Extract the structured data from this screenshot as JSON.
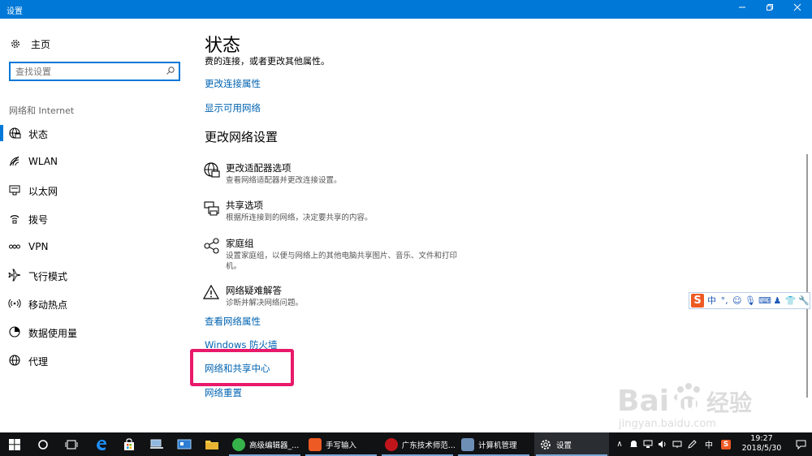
{
  "window": {
    "title": "设置",
    "minimize_icon": "minimize-icon",
    "maximize_icon": "restore-icon",
    "close_icon": "close-icon",
    "accent_color": "#0078d7"
  },
  "sidebar": {
    "home_label": "主页",
    "search_placeholder": "查找设置",
    "section_label": "网络和 Internet",
    "items": [
      {
        "label": "状态",
        "icon": "status-globe-icon",
        "selected": true
      },
      {
        "label": "WLAN",
        "icon": "wifi-icon"
      },
      {
        "label": "以太网",
        "icon": "ethernet-icon"
      },
      {
        "label": "拨号",
        "icon": "dialup-icon"
      },
      {
        "label": "VPN",
        "icon": "vpn-icon"
      },
      {
        "label": "飞行模式",
        "icon": "airplane-icon"
      },
      {
        "label": "移动热点",
        "icon": "hotspot-icon"
      },
      {
        "label": "数据使用量",
        "icon": "data-usage-icon"
      },
      {
        "label": "代理",
        "icon": "proxy-globe-icon"
      }
    ]
  },
  "main": {
    "title": "状态",
    "partial_text": "费的连接，或者更改其他属性。",
    "link_change_connection": "更改连接属性",
    "link_show_networks": "显示可用网络",
    "section_heading": "更改网络设置",
    "settings": [
      {
        "name": "更改适配器选项",
        "desc": "查看网络适配器并更改连接设置。",
        "icon": "adapter-globe-icon"
      },
      {
        "name": "共享选项",
        "desc": "根据所连接到的网络，决定要共享的内容。",
        "icon": "sharing-printer-icon"
      },
      {
        "name": "家庭组",
        "desc": "设置家庭组，以便与网络上的其他电脑共享图片、音乐、文件和打印机。",
        "icon": "homegroup-icon"
      },
      {
        "name": "网络疑难解答",
        "desc": "诊断并解决网络问题。",
        "icon": "warning-triangle-icon"
      }
    ],
    "link_view_properties": "查看网络属性",
    "link_firewall": "Windows 防火墙",
    "link_sharing_center": "网络和共享中心",
    "link_reset": "网络重置",
    "highlight_color": "#e8196a",
    "link_color": "#0063b1"
  },
  "ime_toolbar": {
    "logo": "S",
    "mode": "中",
    "icons": [
      "punctuation-icon",
      "emoji-icon",
      "microphone-icon",
      "keyboard-icon",
      "user-icon",
      "skin-icon",
      "tools-icon"
    ]
  },
  "watermark": {
    "brand": "Bai",
    "brand2": "du",
    "cn": "经验",
    "url": "jingyan.baidu.com"
  },
  "taskbar": {
    "apps": [
      {
        "label": "高级编辑器_...",
        "icon": "advanced-editor-icon",
        "color": "#35b34a"
      },
      {
        "label": "手写输入",
        "icon": "handwriting-icon",
        "color": "#ee5a24"
      },
      {
        "label": "广东技术师范...",
        "icon": "browser-red-icon",
        "color": "#c0161b"
      },
      {
        "label": "计算机管理",
        "icon": "computer-management-icon",
        "color": "#6d8fb6"
      },
      {
        "label": "设置",
        "icon": "settings-gear-icon",
        "color": "#ffffff"
      }
    ],
    "tray_ime": "中",
    "time": "19:27",
    "date": "2018/5/30"
  }
}
